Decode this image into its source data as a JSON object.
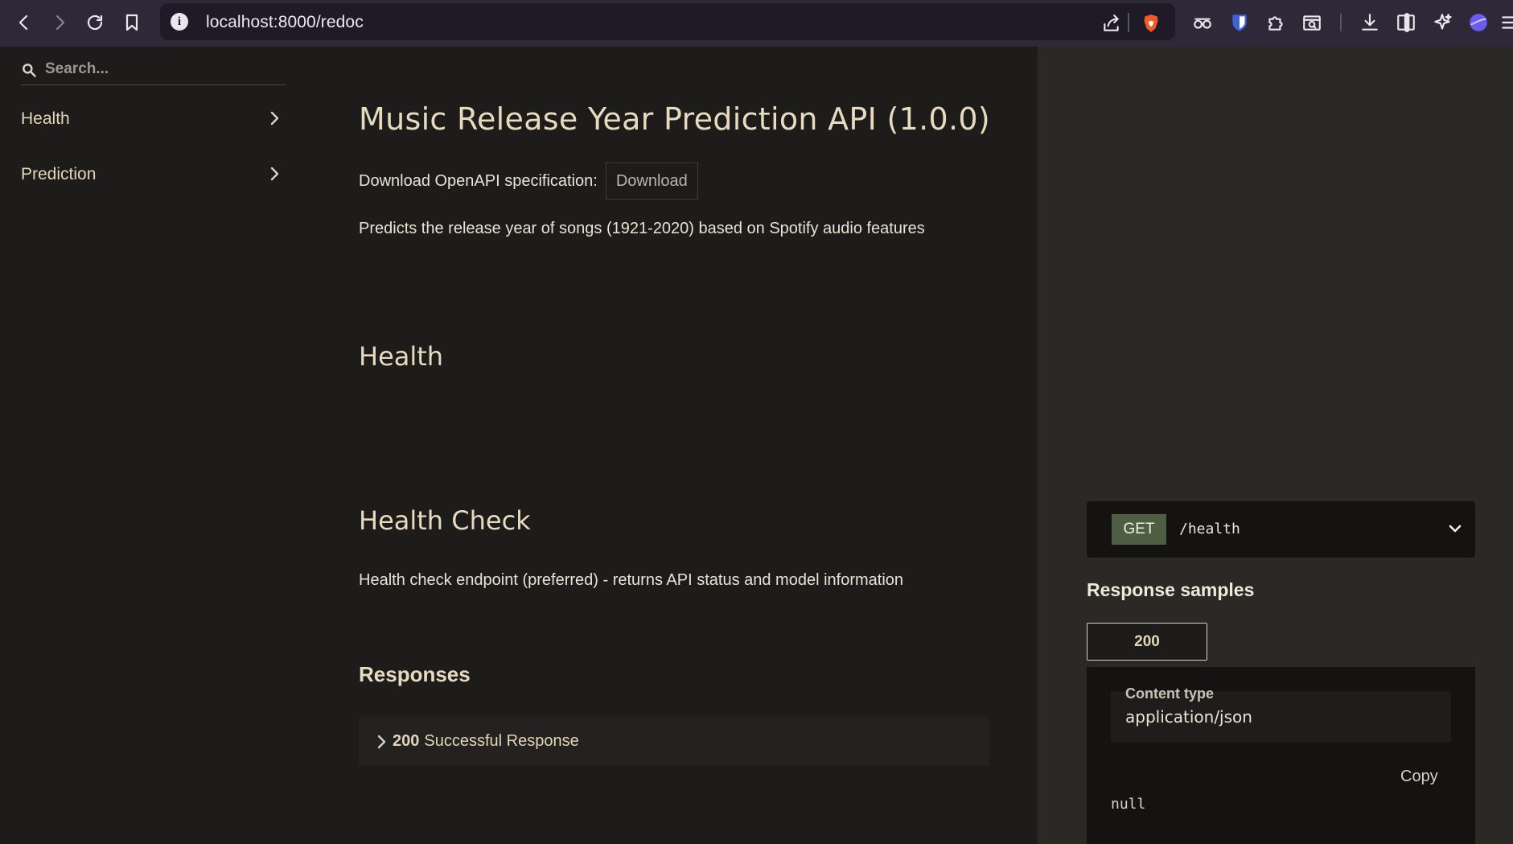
{
  "browser": {
    "url": "localhost:8000/redoc"
  },
  "sidebar": {
    "search_placeholder": "Search...",
    "items": [
      {
        "label": "Health"
      },
      {
        "label": "Prediction"
      }
    ]
  },
  "main": {
    "title": "Music Release Year Prediction API (1.0.0)",
    "download_label": "Download OpenAPI specification:",
    "download_button": "Download",
    "description": "Predicts the release year of songs (1921-2020) based on Spotify audio features",
    "section_title": "Health",
    "operation_title": "Health Check",
    "operation_description": "Health check endpoint (preferred) - returns API status and model information",
    "responses_title": "Responses",
    "response_code": "200",
    "response_text": "Successful Response"
  },
  "right_panel": {
    "method": "GET",
    "path": "/health",
    "samples_title": "Response samples",
    "tab_code": "200",
    "content_type_label": "Content type",
    "content_type_value": "application/json",
    "copy_label": "Copy",
    "sample_value": "null"
  },
  "colors": {
    "chrome_bg": "#2f2838",
    "page_bg": "#1d1c1a",
    "right_panel_bg": "#2a2926",
    "method_get_bg": "#4d5e42",
    "heading": "#e6dbbe"
  }
}
